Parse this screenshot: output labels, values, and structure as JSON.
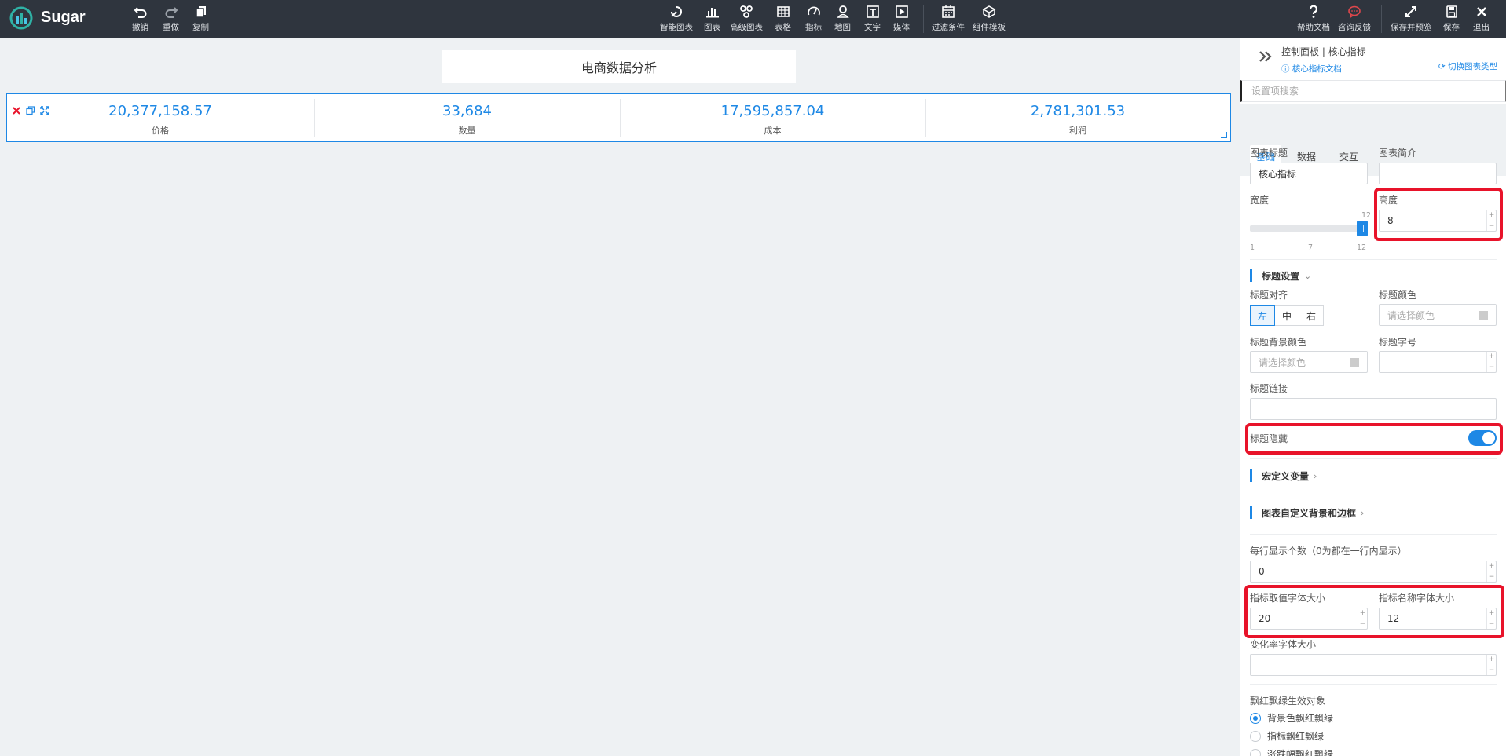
{
  "app": {
    "name": "Sugar"
  },
  "toolbar": {
    "undo": "撤销",
    "redo": "重做",
    "copy": "复制",
    "smart_chart": "智能图表",
    "chart": "图表",
    "advanced_chart": "高级图表",
    "table": "表格",
    "indicator": "指标",
    "map": "地图",
    "text": "文字",
    "media": "媒体",
    "filter": "过滤条件",
    "component_template": "组件模板",
    "help_docs": "帮助文档",
    "feedback": "咨询反馈",
    "save_preview": "保存并预览",
    "save": "保存",
    "exit": "退出"
  },
  "colors": {
    "accent": "#1e88e5",
    "toolbar_bg": "#2f353e",
    "highlight": "#e8132a",
    "feedback_icon": "#e0474c"
  },
  "report": {
    "title": "电商数据分析"
  },
  "kpis": [
    {
      "value": "20,377,158.57",
      "name": "价格"
    },
    {
      "value": "33,684",
      "name": "数量"
    },
    {
      "value": "17,595,857.04",
      "name": "成本"
    },
    {
      "value": "2,781,301.53",
      "name": "利润"
    }
  ],
  "panel": {
    "title": "控制面板 | 核心指标",
    "doc_link": "核心指标文档",
    "switch_type": "切换图表类型",
    "search_placeholder": "设置项搜索",
    "tabs": [
      "基础",
      "数据",
      "交互"
    ],
    "chart_title_label": "图表标题",
    "chart_title_value": "核心指标",
    "chart_desc_label": "图表简介",
    "chart_desc_value": "",
    "width_label": "宽度",
    "width_slider": {
      "min": "1",
      "mid": "7",
      "max": "12",
      "value": "12"
    },
    "height_label": "高度",
    "height_value": "8",
    "title_settings": "标题设置",
    "title_align_label": "标题对齐",
    "align_options": [
      "左",
      "中",
      "右"
    ],
    "title_color_label": "标题颜色",
    "color_placeholder": "请选择颜色",
    "title_bg_color_label": "标题背景颜色",
    "title_font_size_label": "标题字号",
    "title_link_label": "标题链接",
    "title_hidden_label": "标题隐藏",
    "title_hidden": true,
    "macro_vars": "宏定义变量",
    "custom_bg_border": "图表自定义背景和边框",
    "per_row_label": "每行显示个数（0为都在一行内显示）",
    "per_row_value": "0",
    "value_font_size_label": "指标取值字体大小",
    "value_font_size": "20",
    "name_font_size_label": "指标名称字体大小",
    "name_font_size": "12",
    "change_rate_font_label": "变化率字体大小",
    "red_green_label": "飘红飘绿生效对象",
    "red_green_options": [
      "背景色飘红飘绿",
      "指标飘红飘绿",
      "涨跌幅飘红飘绿"
    ]
  }
}
